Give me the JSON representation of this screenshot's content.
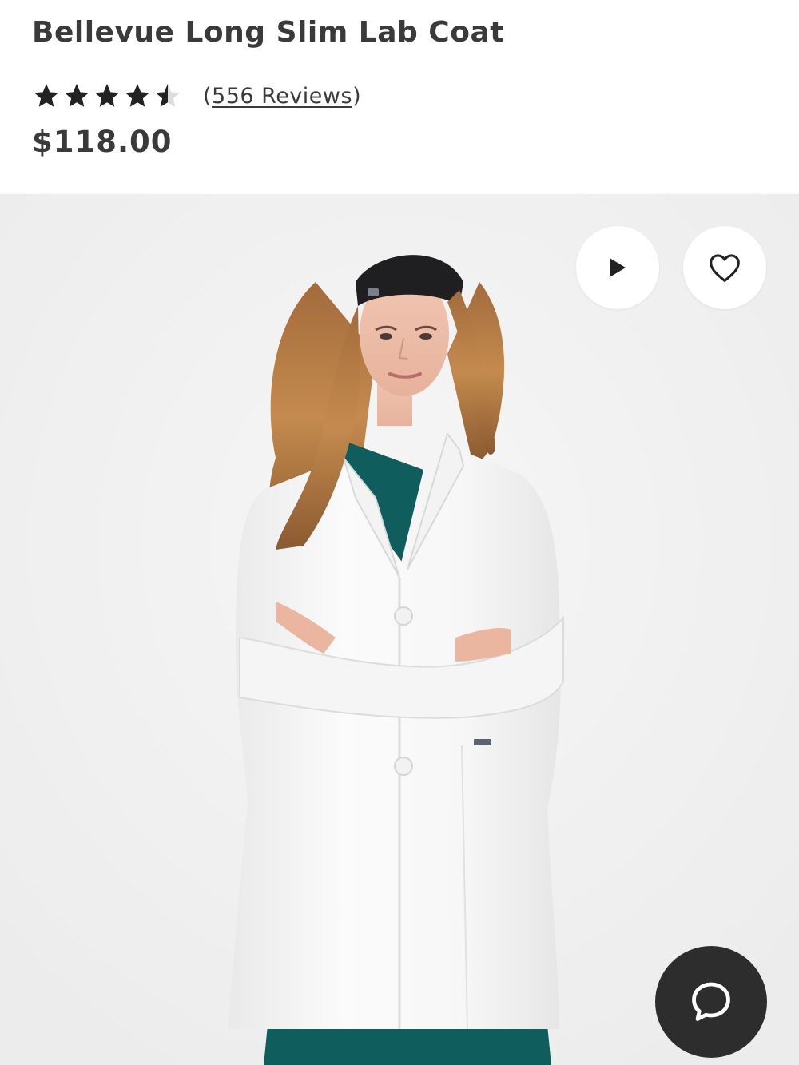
{
  "product": {
    "title": "Bellevue Long Slim Lab Coat",
    "rating": 4.5,
    "rating_max": 5,
    "reviews_link": "556 Reviews",
    "price": "$118.00"
  },
  "colors": {
    "text": "#3a3a3a",
    "star": "#222222",
    "star_empty": "#dcdcdc",
    "gallery_bg": "#efefef",
    "chat_button": "#2d2d2d",
    "scrub_teal": "#0f5d5d"
  },
  "icons": {
    "play": "play-icon",
    "favorite": "heart-icon",
    "chat": "chat-bubble-icon",
    "star": "star-icon"
  }
}
